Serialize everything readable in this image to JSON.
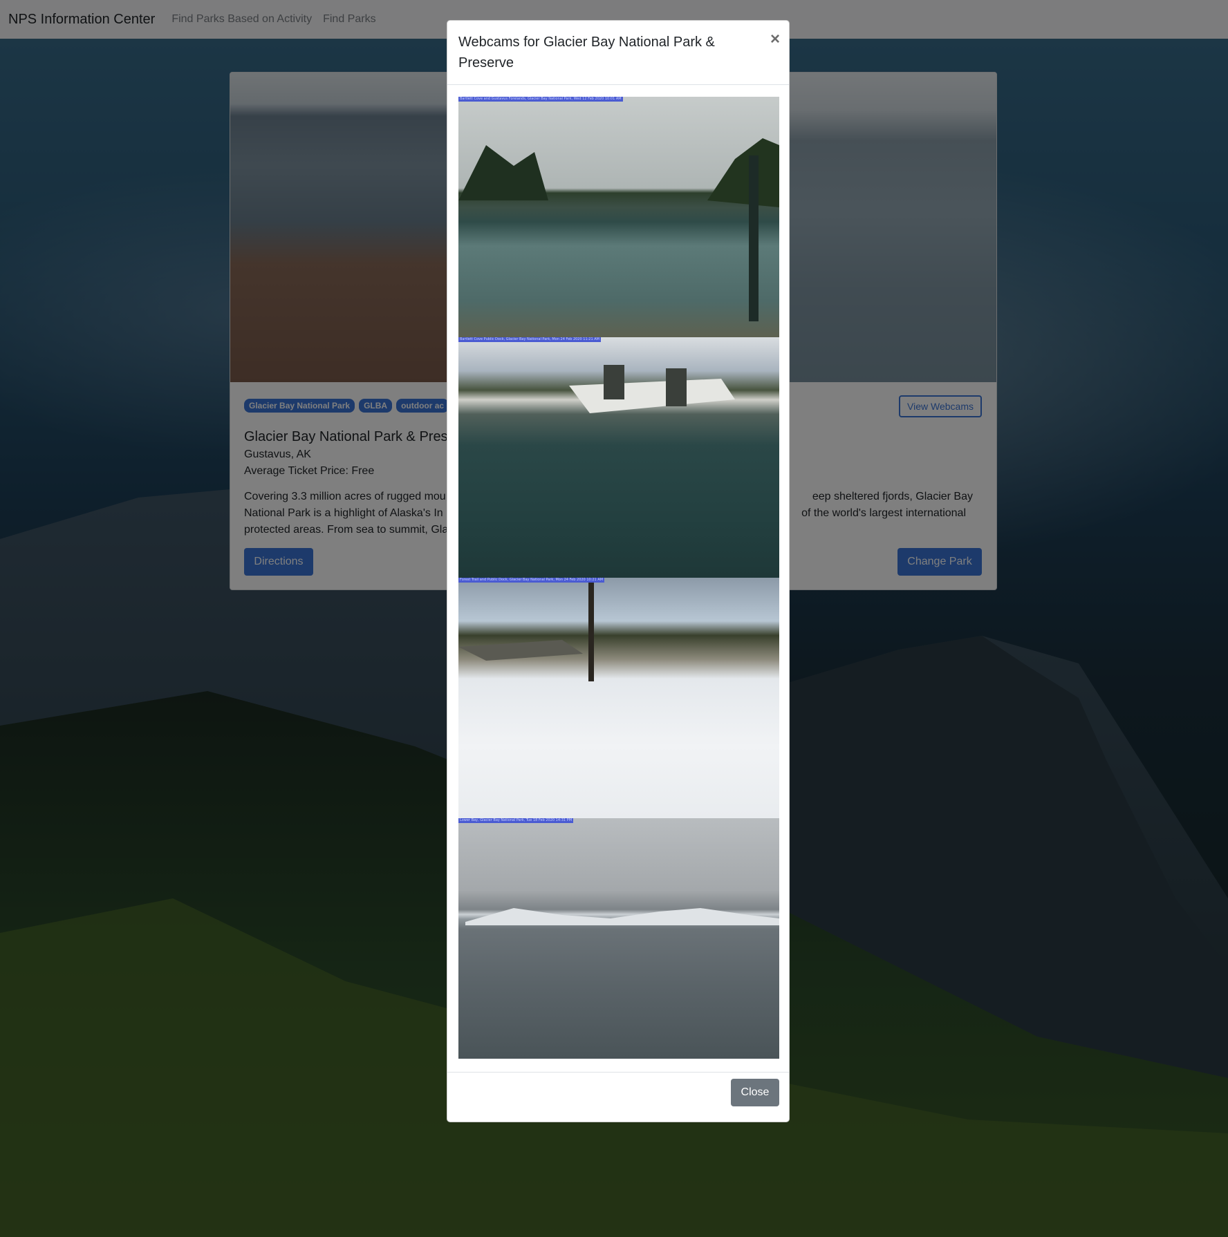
{
  "navbar": {
    "brand": "NPS Information Center",
    "links": [
      "Find Parks Based on Activity",
      "Find Parks"
    ]
  },
  "park": {
    "badges": [
      "Glacier Bay National Park",
      "GLBA",
      "outdoor ac"
    ],
    "title": "Glacier Bay National Park & Prese",
    "location": "Gustavus, AK",
    "price": "Average Ticket Price: Free",
    "description_lines": [
      "Covering 3.3 million acres of rugged mou",
      "eep sheltered fjords, Glacier Bay",
      "National Park is a highlight of Alaska's In",
      "of the world's largest international",
      "protected areas. From sea to summit, Gla"
    ],
    "view_webcams_label": "View Webcams",
    "directions_label": "Directions",
    "change_park_label": "Change Park"
  },
  "modal": {
    "title": "Webcams for Glacier Bay National Park & Preserve",
    "close_x": "×",
    "close_label": "Close",
    "webcams": [
      {
        "name": "webcam-1",
        "label": "Bartlett Cove and Gustavus Forelands, Glacier Bay National Park, Wed 12 Feb 2020 10:01 AM"
      },
      {
        "name": "webcam-2",
        "label": "Bartlett Cove Public Dock, Glacier Bay National Park, Mon 24 Feb 2020 11:21 AM"
      },
      {
        "name": "webcam-3",
        "label": "Forest Trail and Public Dock, Glacier Bay National Park, Mon 24 Feb 2020 10:21 AM"
      },
      {
        "name": "webcam-4",
        "label": "Lower Bay, Glacier Bay National Park, Tue 18 Feb 2020 14:31 PM"
      }
    ]
  },
  "colors": {
    "primary": "#3a75d6",
    "secondary": "#6c757d",
    "navbar_bg": "#f8f9fa"
  }
}
